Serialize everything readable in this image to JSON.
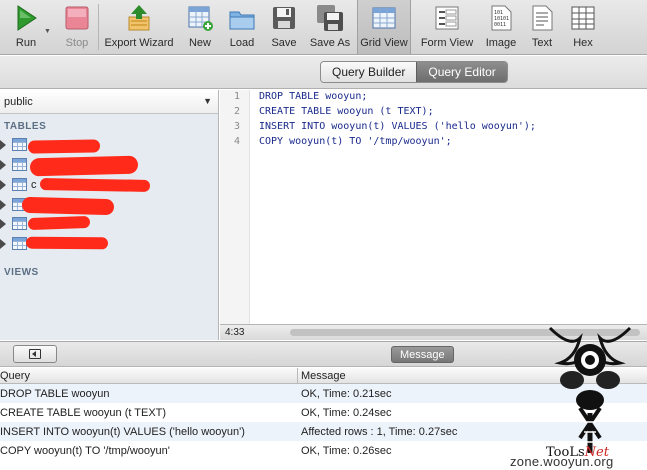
{
  "toolbar": {
    "buttons": [
      {
        "label": "Run",
        "icon": "run-icon"
      },
      {
        "label": "Stop",
        "icon": "stop-icon"
      },
      {
        "label": "Export Wizard",
        "icon": "export-wizard-icon"
      },
      {
        "label": "New",
        "icon": "new-table-icon"
      },
      {
        "label": "Load",
        "icon": "folder-icon"
      },
      {
        "label": "Save",
        "icon": "save-icon"
      },
      {
        "label": "Save As",
        "icon": "save-as-icon"
      },
      {
        "label": "Grid View",
        "icon": "grid-view-icon"
      },
      {
        "label": "Form View",
        "icon": "form-view-icon"
      },
      {
        "label": "Image",
        "icon": "image-icon"
      },
      {
        "label": "Text",
        "icon": "text-icon"
      },
      {
        "label": "Hex",
        "icon": "hex-icon"
      }
    ]
  },
  "view_switch": {
    "query_builder": "Query Builder",
    "query_editor": "Query Editor",
    "selected": "Query Editor"
  },
  "sidebar": {
    "schema": "public",
    "tables_header": "TABLES",
    "views_header": "VIEWS",
    "table_names_partial": [
      "",
      "",
      "c",
      "",
      "",
      ""
    ]
  },
  "editor": {
    "lines": [
      {
        "n": "1",
        "text": "DROP TABLE wooyun;"
      },
      {
        "n": "2",
        "text": "CREATE TABLE wooyun (t TEXT);"
      },
      {
        "n": "3",
        "text": "INSERT INTO wooyun(t) VALUES ('hello wooyun');"
      },
      {
        "n": "4",
        "text": "COPY wooyun(t) TO '/tmp/wooyun';"
      }
    ],
    "cursor_position": "4:33"
  },
  "results": {
    "tab": "Message",
    "columns": [
      "Query",
      "Message"
    ],
    "rows": [
      {
        "query": "DROP TABLE wooyun",
        "message": "OK, Time: 0.21sec"
      },
      {
        "query": "CREATE TABLE wooyun (t TEXT)",
        "message": "OK, Time: 0.24sec"
      },
      {
        "query": "INSERT INTO wooyun(t) VALUES ('hello wooyun')",
        "message": "Affected rows : 1, Time: 0.27sec"
      },
      {
        "query": "COPY wooyun(t) TO '/tmp/wooyun'",
        "message": "OK, Time: 0.26sec"
      }
    ]
  },
  "watermark": {
    "site": "zone.wooyun.org",
    "brand_main": "TooLs",
    "brand_net": "Net"
  },
  "colors": {
    "redaction": "#ff2a1a",
    "run_green": "#2e9a2e",
    "stop_pink": "#e77a8a",
    "sql_text": "#1a2a8c",
    "alt_row": "#edf3fb"
  }
}
